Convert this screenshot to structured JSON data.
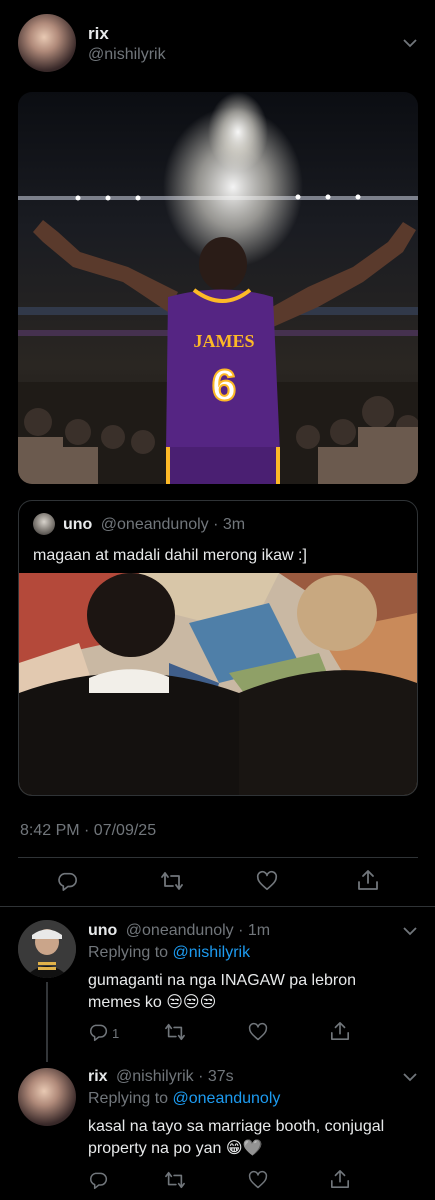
{
  "main_tweet": {
    "author_name": "rix",
    "author_handle": "@nishilyrik",
    "photo_jersey_name": "JAMES",
    "photo_jersey_number": "6",
    "quote": {
      "author_name": "uno",
      "author_handle": "@oneandunoly",
      "time": "3m",
      "text": "magaan at madali dahil merong ikaw :]"
    },
    "timestamp": "8:42 PM · 07/09/25"
  },
  "replies": [
    {
      "author_name": "uno",
      "author_handle": "@oneandunoly",
      "time": "1m",
      "replying_prefix": "Replying to ",
      "replying_to": "@nishilyrik",
      "text": "gumaganti na nga INAGAW pa lebron memes ko 😒😒😒",
      "reply_count": "1"
    },
    {
      "author_name": "rix",
      "author_handle": "@nishilyrik",
      "time": "37s",
      "replying_prefix": "Replying to ",
      "replying_to": "@oneandunoly",
      "text": "kasal na tayo sa marriage booth, conjugal property na po yan 😁🩶"
    }
  ],
  "colors": {
    "background": "#000000",
    "text": "#e7e9ea",
    "muted": "#71767b",
    "link": "#1d9bf0",
    "jersey": "#552583",
    "jersey_trim": "#fdb927"
  }
}
